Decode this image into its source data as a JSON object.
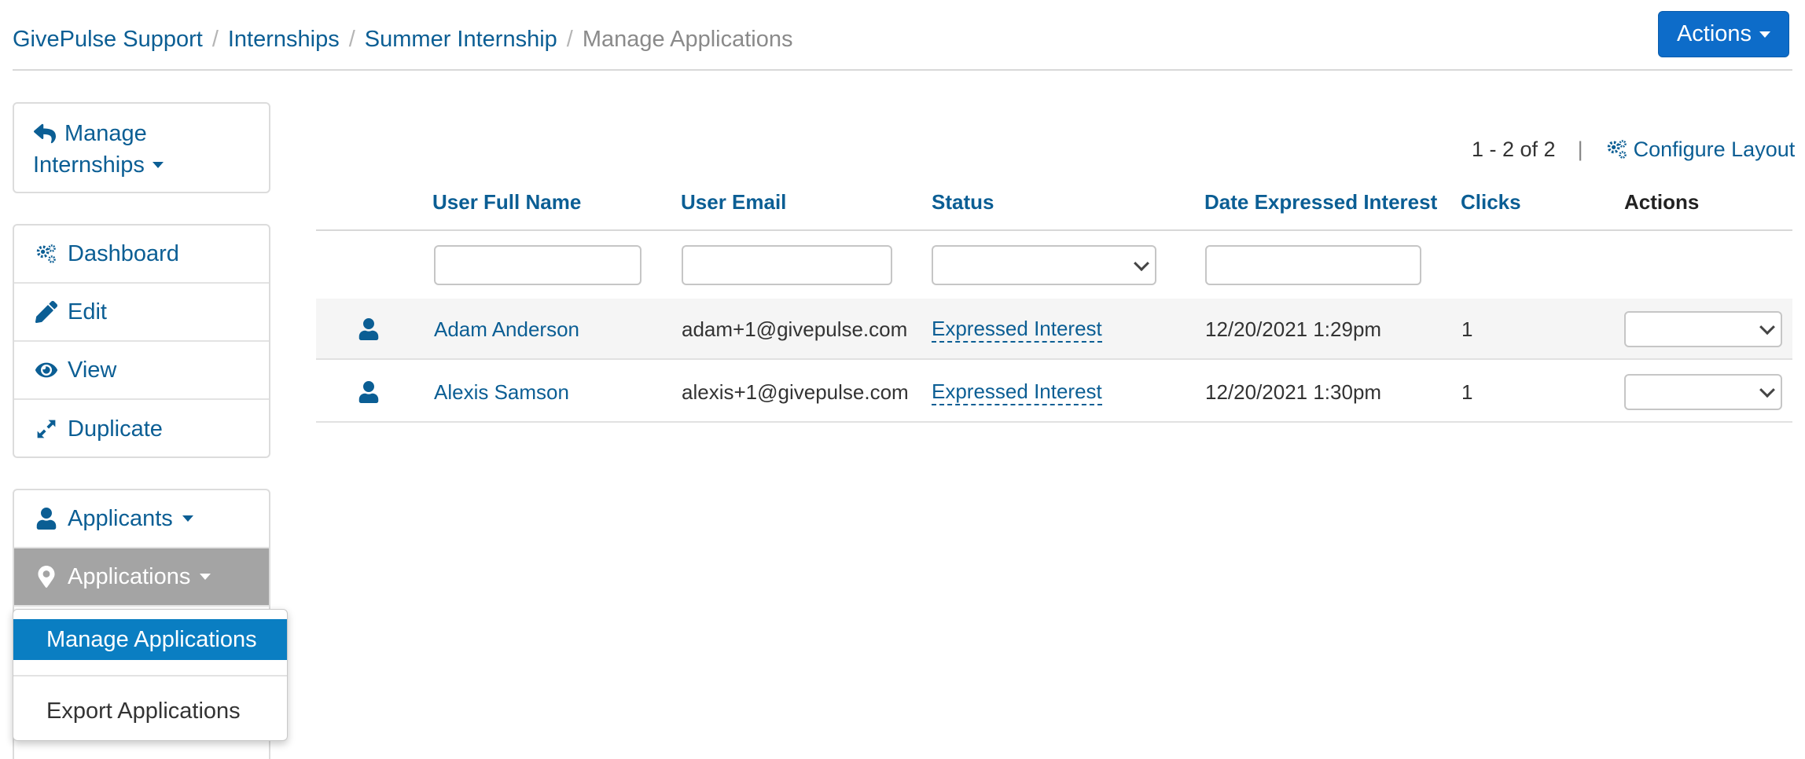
{
  "breadcrumb": {
    "items": [
      "GivePulse Support",
      "Internships",
      "Summer Internship"
    ],
    "current": "Manage Applications",
    "separator": "/"
  },
  "header": {
    "actions_label": "Actions"
  },
  "sidebar": {
    "manage": {
      "line1": "Manage",
      "line2": "Internships"
    },
    "nav": [
      {
        "label": "Dashboard",
        "icon": "gears-icon"
      },
      {
        "label": "Edit",
        "icon": "pencil-icon"
      },
      {
        "label": "View",
        "icon": "eye-icon"
      },
      {
        "label": "Duplicate",
        "icon": "expand-arrows-icon"
      }
    ],
    "applicants_label": "Applicants",
    "applications_label": "Applications"
  },
  "dropdown": {
    "items": [
      "Manage Applications",
      "Export Applications"
    ]
  },
  "pager": {
    "range": "1 - 2 of 2",
    "separator": "|",
    "configure_label": "Configure Layout"
  },
  "table": {
    "columns": [
      "User Full Name",
      "User Email",
      "Status",
      "Date Expressed Interest",
      "Clicks",
      "Actions"
    ],
    "rows": [
      {
        "name": "Adam Anderson",
        "email": "adam+1@givepulse.com",
        "status": "Expressed Interest",
        "date": "12/20/2021 1:29pm",
        "clicks": "1"
      },
      {
        "name": "Alexis Samson",
        "email": "alexis+1@givepulse.com",
        "status": "Expressed Interest",
        "date": "12/20/2021 1:30pm",
        "clicks": "1"
      }
    ]
  },
  "colors": {
    "link": "#0b5e94",
    "primary_button": "#0d6cc9",
    "active_menu": "#0a7ec2",
    "active_nav": "#a4a4a4"
  }
}
